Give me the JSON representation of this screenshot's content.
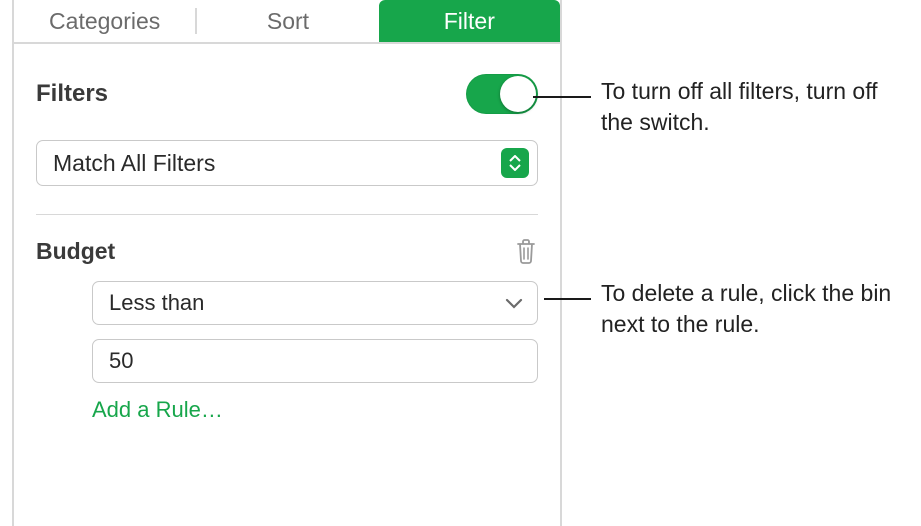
{
  "tabs": {
    "categories": "Categories",
    "sort": "Sort",
    "filter": "Filter"
  },
  "filters": {
    "title": "Filters",
    "match_mode": "Match All Filters"
  },
  "rules": [
    {
      "column": "Budget",
      "operator": "Less than",
      "value": "50"
    }
  ],
  "actions": {
    "add_rule": "Add a Rule…"
  },
  "callouts": {
    "toggle": "To turn off all filters, turn off the switch.",
    "delete": "To delete a rule, click the bin next to the rule."
  },
  "colors": {
    "accent": "#17a64b"
  }
}
